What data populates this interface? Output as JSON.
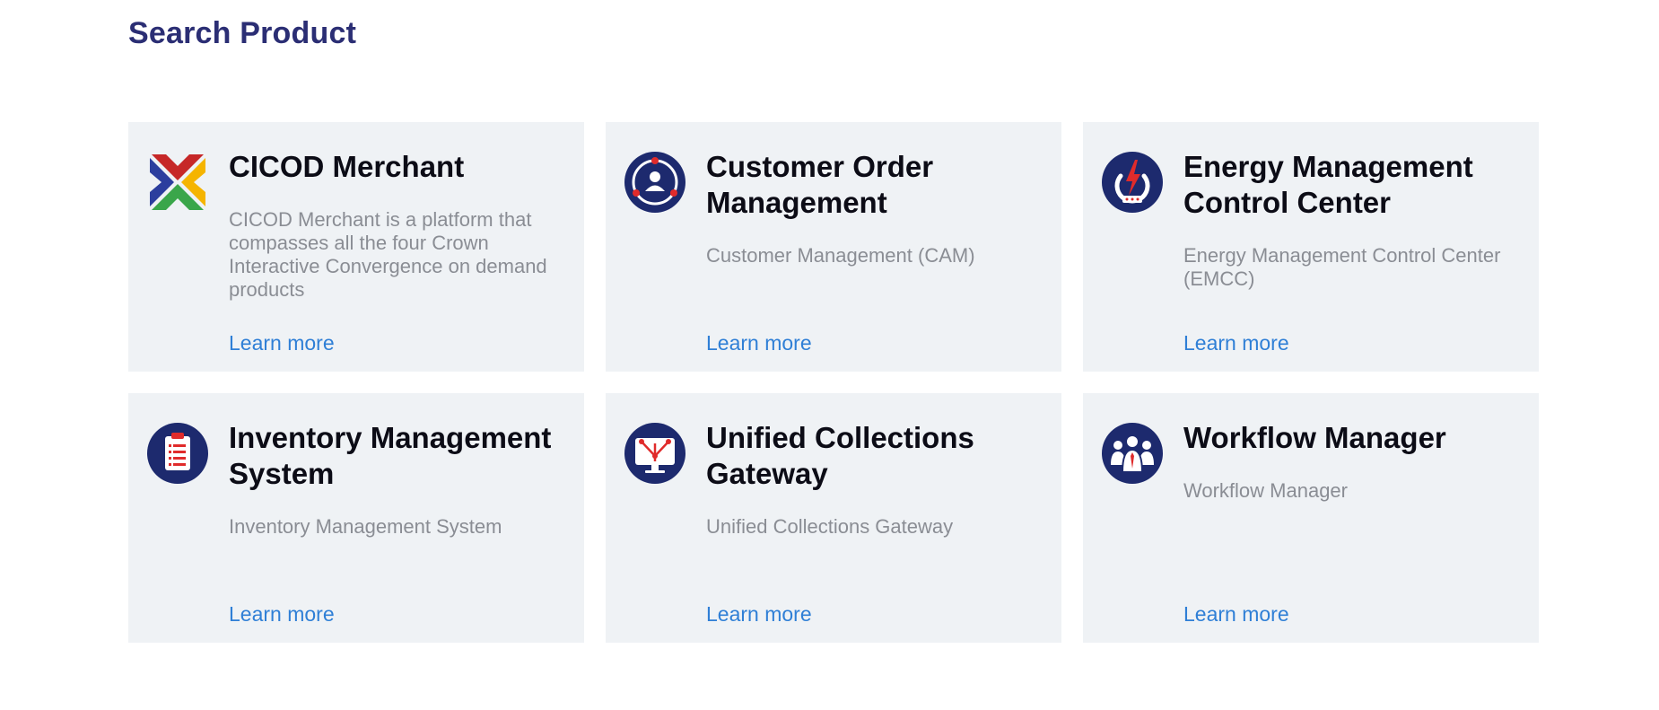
{
  "page": {
    "title": "Search Product"
  },
  "products": [
    {
      "icon": "cicod-logo-icon",
      "title": "CICOD Merchant",
      "description": "CICOD Merchant is a platform that compasses all the four Crown Interactive Convergence on demand products",
      "link_label": "Learn more"
    },
    {
      "icon": "customer-order-icon",
      "title": "Customer Order Management",
      "description": "Customer Management (CAM)",
      "link_label": "Learn more"
    },
    {
      "icon": "energy-management-icon",
      "title": "Energy Management Control Center",
      "description": "Energy Management Control Center (EMCC)",
      "link_label": "Learn more"
    },
    {
      "icon": "inventory-clipboard-icon",
      "title": "Inventory Management System",
      "description": "Inventory Management System",
      "link_label": "Learn more"
    },
    {
      "icon": "collections-gateway-icon",
      "title": "Unified Collections Gateway",
      "description": "Unified Collections Gateway",
      "link_label": "Learn more"
    },
    {
      "icon": "workflow-team-icon",
      "title": "Workflow Manager",
      "description": "Workflow Manager",
      "link_label": "Learn more"
    }
  ],
  "colors": {
    "title": "#2b2e74",
    "card_bg": "#eff2f5",
    "link": "#2f7fd6",
    "icon_navy": "#1d2a6e",
    "icon_red": "#e02b2b"
  }
}
